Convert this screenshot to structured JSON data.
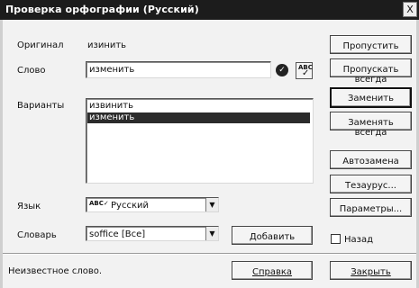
{
  "window": {
    "title": "Проверка орфографии (Русский)",
    "close_glyph": "X"
  },
  "form": {
    "original_label": "Оригинал",
    "original_value": "изинить",
    "word_label": "Слово",
    "word_value": "изменить",
    "variants_label": "Варианты",
    "variants": [
      "извинить",
      "изменить"
    ],
    "selected_variant_index": 1,
    "language_label": "Язык",
    "language_value": "Русский",
    "dictionary_label": "Словарь",
    "dictionary_value": "soffice [Все]"
  },
  "buttons": {
    "skip": "Пропустить",
    "skip_always": "Пропускать всегда",
    "replace": "Заменить",
    "replace_always": "Заменять всегда",
    "autocorrect": "Автозамена",
    "thesaurus": "Тезаурус...",
    "options": "Параметры...",
    "add": "Добавить",
    "help": "Справка",
    "close": "Закрыть"
  },
  "checkbox_back": {
    "label": "Назад",
    "checked": false
  },
  "status": {
    "text": "Неизвестное слово."
  },
  "icons": {
    "apply": "check-circle-icon",
    "spellcheck": "spellcheck-icon",
    "language": "spellcheck-icon",
    "dropdown": "chevron-down-icon"
  }
}
